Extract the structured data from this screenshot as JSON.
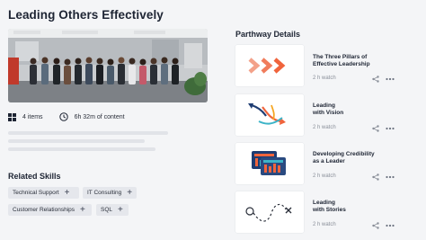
{
  "page": {
    "title": "Leading Others Effectively"
  },
  "meta": {
    "items_icon": "grid-icon",
    "items_text": "4 items",
    "duration_icon": "clock-icon",
    "duration_text": "6h 32m of content"
  },
  "related_skills": {
    "title": "Related Skills",
    "skills": [
      {
        "label": "Technical Support",
        "icon": "plus-icon"
      },
      {
        "label": "IT Consulting",
        "icon": "plus-icon"
      },
      {
        "label": "Customer Relationships",
        "icon": "plus-icon"
      },
      {
        "label": "SQL",
        "icon": "plus-icon"
      }
    ]
  },
  "pathway": {
    "title": "Parthway Details",
    "items": [
      {
        "title_line1": "The Three Pillars of",
        "title_line2": "Effective Leadership",
        "duration": "2 h watch",
        "thumbnail": "chevrons-icon"
      },
      {
        "title_line1": "Leading",
        "title_line2": "with Vision",
        "duration": "2 h watch",
        "thumbnail": "arrows-icon"
      },
      {
        "title_line1": "Developing Credibility",
        "title_line2": "as a Leader",
        "duration": "2 h watch",
        "thumbnail": "bar-chart-icon"
      },
      {
        "title_line1": "Leading",
        "title_line2": "with Stories",
        "duration": "2 h watch",
        "thumbnail": "path-icon"
      }
    ]
  },
  "colors": {
    "accent_orange": "#f0643c",
    "accent_teal": "#3cb4c8",
    "accent_navy": "#1e3c72"
  }
}
